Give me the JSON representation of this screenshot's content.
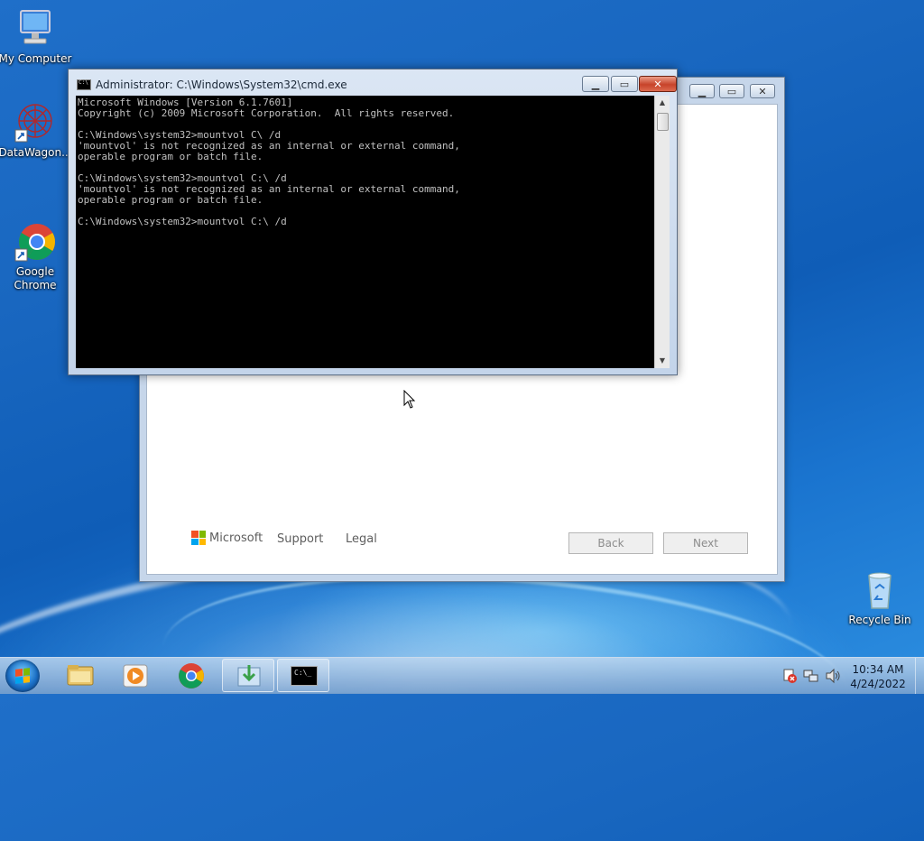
{
  "desktop": {
    "icons": [
      {
        "label": "My Computer"
      },
      {
        "label": "DataWagon..."
      },
      {
        "label": "Google\nChrome"
      },
      {
        "label": "Recycle Bin"
      }
    ]
  },
  "wizard": {
    "brand": "Microsoft",
    "support_label": "Support",
    "legal_label": "Legal",
    "back_label": "Back",
    "next_label": "Next"
  },
  "cmd": {
    "title": "Administrator: C:\\Windows\\System32\\cmd.exe",
    "lines": [
      "Microsoft Windows [Version 6.1.7601]",
      "Copyright (c) 2009 Microsoft Corporation.  All rights reserved.",
      "",
      "C:\\Windows\\system32>mountvol C\\ /d",
      "'mountvol' is not recognized as an internal or external command,",
      "operable program or batch file.",
      "",
      "C:\\Windows\\system32>mountvol C:\\ /d",
      "'mountvol' is not recognized as an internal or external command,",
      "operable program or batch file.",
      "",
      "C:\\Windows\\system32>mountvol C:\\ /d"
    ]
  },
  "taskbar": {
    "clock_time": "10:34 AM",
    "clock_date": "4/24/2022",
    "cmd_button_text": "C:\\_"
  },
  "colors": {
    "ms_red": "#f25022",
    "ms_green": "#7fba00",
    "ms_blue": "#00a4ef",
    "ms_yellow": "#ffb900"
  }
}
